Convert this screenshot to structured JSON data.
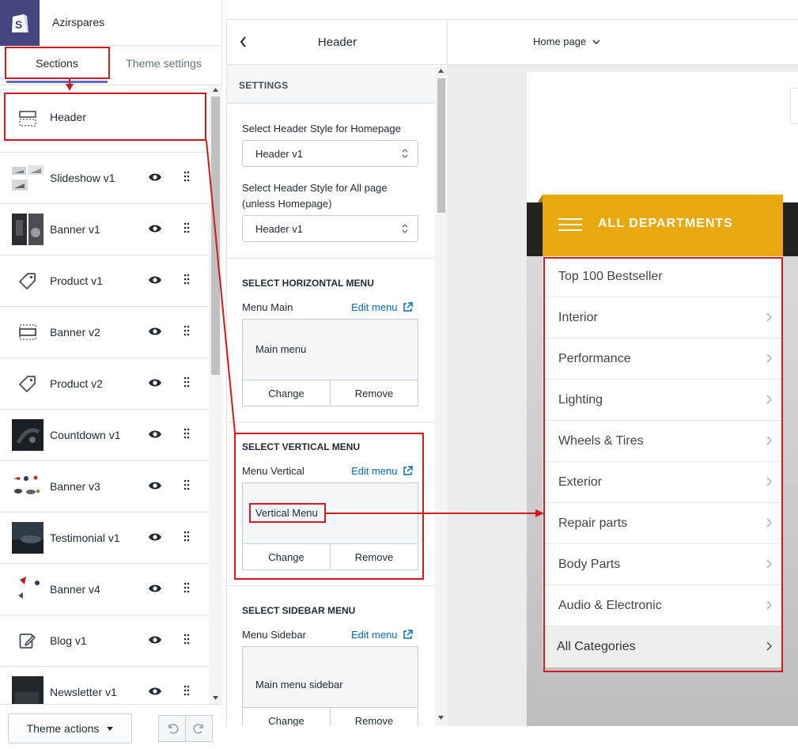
{
  "store": {
    "name": "Azirspares"
  },
  "tabs": {
    "sections": "Sections",
    "theme_settings": "Theme settings"
  },
  "sections": [
    {
      "name": "Header",
      "icon": "header-layout-icon"
    },
    {
      "name": "Slideshow v1",
      "icon": "slideshow-thumbnail"
    },
    {
      "name": "Banner v1",
      "icon": "banner-thumbnail"
    },
    {
      "name": "Product v1",
      "icon": "tag-icon"
    },
    {
      "name": "Banner v2",
      "icon": "banner-layout-icon"
    },
    {
      "name": "Product v2",
      "icon": "tag-icon"
    },
    {
      "name": "Countdown v1",
      "icon": "countdown-thumbnail"
    },
    {
      "name": "Banner v3",
      "icon": "banner-thumbnail"
    },
    {
      "name": "Testimonial v1",
      "icon": "testimonial-thumbnail"
    },
    {
      "name": "Banner v4",
      "icon": "banner-thumbnail"
    },
    {
      "name": "Blog v1",
      "icon": "blog-edit-icon"
    },
    {
      "name": "Newsletter v1",
      "icon": "newsletter-thumbnail"
    }
  ],
  "footer": {
    "theme_actions": "Theme actions"
  },
  "settings": {
    "title": "Header",
    "group_label": "SETTINGS",
    "homepage_style_label": "Select Header Style for Homepage",
    "homepage_style_value": "Header v1",
    "allpage_style_label": "Select Header Style for All page (unless Homepage)",
    "allpage_style_value": "Header v1",
    "horizontal": {
      "title": "SELECT HORIZONTAL MENU",
      "label": "Menu Main",
      "edit": "Edit menu",
      "menu": "Main menu",
      "change": "Change",
      "remove": "Remove"
    },
    "vertical": {
      "title": "SELECT VERTICAL MENU",
      "label": "Menu Vertical",
      "edit": "Edit menu",
      "menu": "Vertical Menu",
      "change": "Change",
      "remove": "Remove"
    },
    "sidebar": {
      "title": "SELECT SIDEBAR MENU",
      "label": "Menu Sidebar",
      "edit": "Edit menu",
      "menu": "Main menu sidebar",
      "change": "Change",
      "remove": "Remove"
    }
  },
  "top_nav": {
    "page": "Home page"
  },
  "preview": {
    "departments_label": "ALL DEPARTMENTS",
    "departments": [
      {
        "label": "Top 100 Bestseller",
        "chevron": false
      },
      {
        "label": "Interior",
        "chevron": true
      },
      {
        "label": "Performance",
        "chevron": true
      },
      {
        "label": "Lighting",
        "chevron": true
      },
      {
        "label": "Wheels & Tires",
        "chevron": true
      },
      {
        "label": "Exterior",
        "chevron": true
      },
      {
        "label": "Repair parts",
        "chevron": true
      },
      {
        "label": "Body Parts",
        "chevron": true
      },
      {
        "label": "Audio & Electronic",
        "chevron": true
      },
      {
        "label": "All Categories",
        "chevron": true
      }
    ]
  },
  "colors": {
    "accent": "#5c6ac4",
    "department_bar": "#e8a90e",
    "annotation": "#d41820",
    "link": "#006fbb",
    "shopify_bg": "#43467f"
  }
}
